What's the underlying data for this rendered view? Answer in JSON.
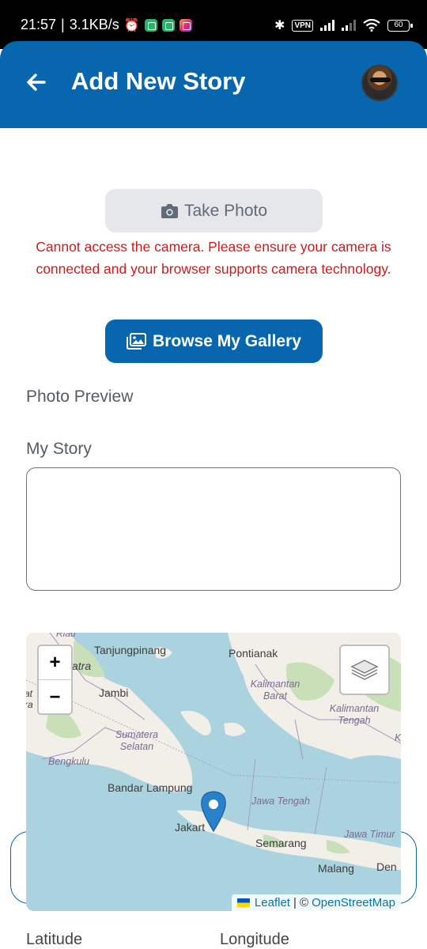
{
  "status_bar": {
    "time": "21:57",
    "network_speed": "3.1KB/s",
    "vpn": "VPN",
    "battery": "60"
  },
  "header": {
    "title": "Add New Story"
  },
  "camera": {
    "take_photo_label": "Take Photo",
    "error": "Cannot access the camera. Please ensure your camera is connected and your browser supports camera technology."
  },
  "gallery": {
    "browse_label": "Browse My Gallery"
  },
  "preview": {
    "label": "Photo Preview"
  },
  "story": {
    "label": "My Story",
    "value": ""
  },
  "map": {
    "zoom_in": "+",
    "zoom_out": "−",
    "places": {
      "riau": "Riau",
      "tanjungpinang": "Tanjungpinang",
      "pontianak": "Pontianak",
      "sumatra": "atra",
      "jambi": "Jambi",
      "bengkulu": "Bengkulu",
      "bandar_lampung": "Bandar Lampung",
      "jakarta": "Jakart",
      "semarang": "Semarang",
      "malang": "Malang",
      "denpasar": "Den",
      "left_cut_1": "at",
      "left_cut_2": "ra"
    },
    "regions": {
      "kalimantan_barat": "Kalimantan Barat",
      "kalimantan_tengah": "Kalimantan Tengah",
      "sumatera_selatan": "Sumatera Selatan",
      "jawa_tengah": "Jawa Tengah",
      "jawa_timur": "Jawa Timur",
      "edge_k": "K"
    },
    "attribution": {
      "leaflet": "Leaflet",
      "separator": "| ©",
      "osm": "OpenStreetMap"
    }
  },
  "coordinates": {
    "latitude_label": "Latitude",
    "longitude_label": "Longitude"
  },
  "colors": {
    "primary": "#0766ad",
    "error": "#d11a1a",
    "disabled_button": "#e5e7eb",
    "sea": "#aad3df",
    "land": "#f2efe9"
  }
}
